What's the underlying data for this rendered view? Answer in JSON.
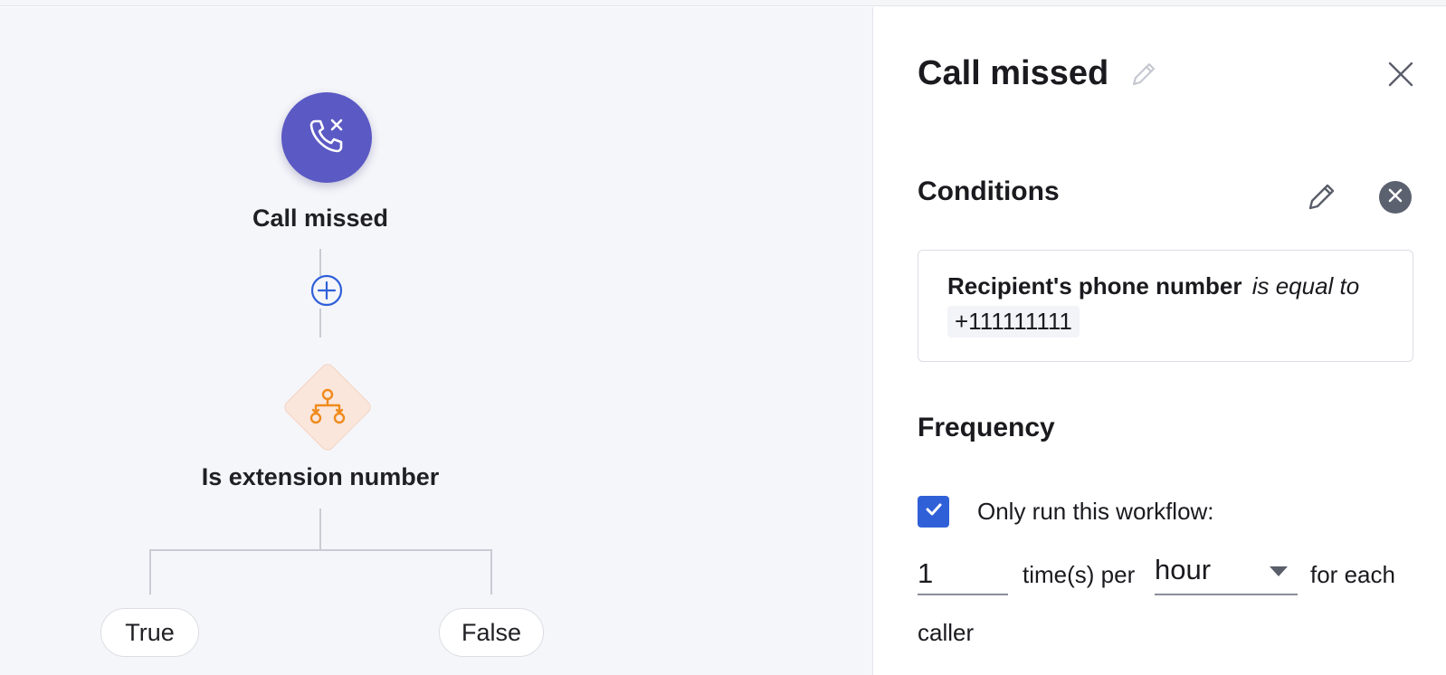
{
  "canvas": {
    "trigger": {
      "label": "Call missed",
      "icon": "phone-missed-icon"
    },
    "add_step_icon": "plus-circle-icon",
    "condition": {
      "label": "Is extension number",
      "icon": "branch-tree-icon"
    },
    "branches": {
      "true_label": "True",
      "false_label": "False"
    }
  },
  "panel": {
    "title": "Call missed",
    "title_edit_icon": "pencil-icon",
    "close_icon": "close-icon",
    "conditions": {
      "heading": "Conditions",
      "edit_icon": "pencil-icon",
      "remove_icon": "close-circle-icon",
      "field": "Recipient's phone number",
      "operator": "is equal to",
      "value": "+111111111"
    },
    "frequency": {
      "heading": "Frequency",
      "checkbox_checked": true,
      "checkbox_label": "Only run this workflow:",
      "count": "1",
      "per_label": "time(s) per",
      "period": "hour",
      "for_each_label": "for each",
      "target": "caller"
    }
  },
  "colors": {
    "trigger_node": "#5b59c4",
    "condition_node": "#fbe6dc",
    "condition_icon": "#f08a1c",
    "checkbox": "#3060d8",
    "add_step": "#3060d8"
  }
}
